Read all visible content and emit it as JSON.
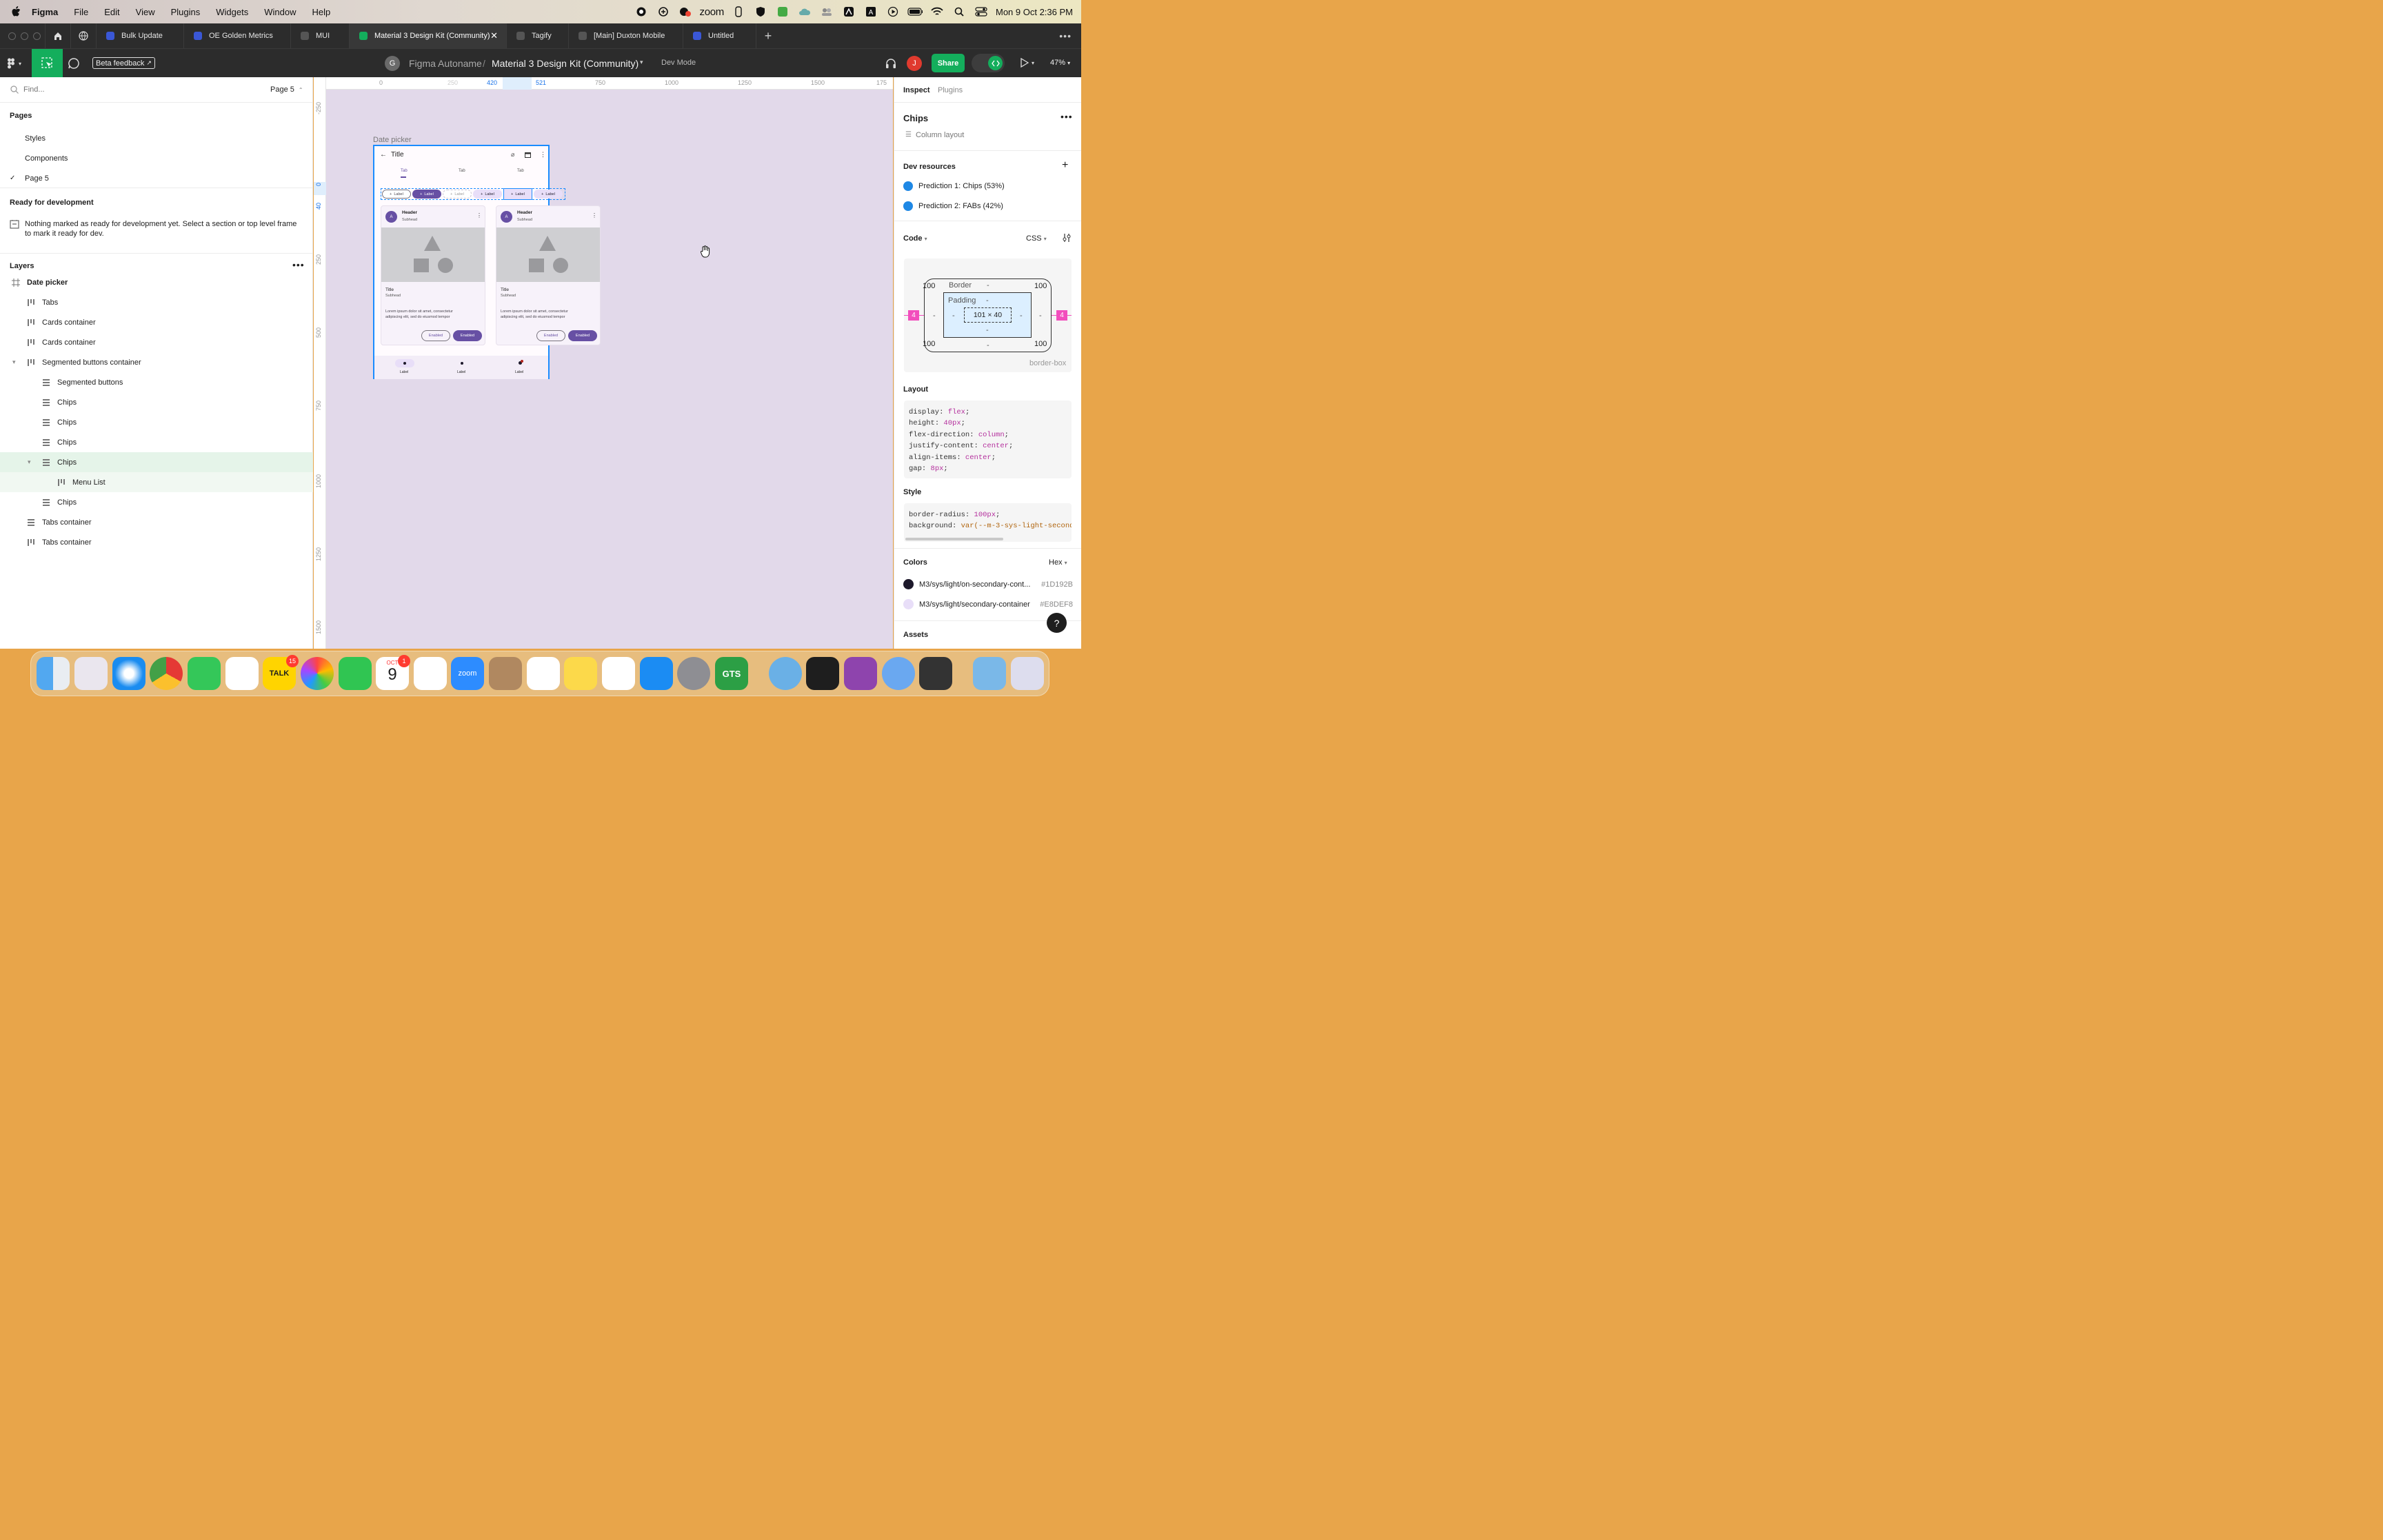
{
  "menubar": {
    "app": "Figma",
    "items": [
      "File",
      "Edit",
      "View",
      "Plugins",
      "Widgets",
      "Window",
      "Help"
    ],
    "status_zoom": "zoom",
    "clock": "Mon 9 Oct  2:36 PM"
  },
  "browser_tabs": [
    {
      "label": "Bulk Update",
      "color": "#3a57d6"
    },
    {
      "label": "OE Golden Metrics",
      "color": "#3a57d6"
    },
    {
      "label": "MUI",
      "color": "#555"
    },
    {
      "label": "Material 3 Design Kit (Community)",
      "color": "#14ae5c",
      "active": true
    },
    {
      "label": "Tagify",
      "color": "#555"
    },
    {
      "label": "[Main] Duxton Mobile",
      "color": "#555"
    },
    {
      "label": "Untitled",
      "color": "#3a57d6"
    }
  ],
  "toolbar": {
    "beta": "Beta feedback",
    "team_initial": "G",
    "team": "Figma Autoname",
    "sep": "/",
    "file": "Material 3 Design Kit (Community)",
    "devmode": "Dev Mode",
    "user_initial": "J",
    "share": "Share",
    "zoom": "47%"
  },
  "left": {
    "search_placeholder": "Find...",
    "page_select": "Page 5",
    "pages_title": "Pages",
    "pages": [
      "Styles",
      "Components",
      "Page 5"
    ],
    "ready_title": "Ready for development",
    "ready_text": "Nothing marked as ready for development yet. Select a section or top level frame to mark it ready for dev.",
    "layers_title": "Layers",
    "layers": [
      {
        "label": "Date picker",
        "icon": "frame-icon",
        "indent": 0,
        "bold": true
      },
      {
        "label": "Tabs",
        "icon": "autolayout-v-icon",
        "indent": 1
      },
      {
        "label": "Cards container",
        "icon": "autolayout-v-icon",
        "indent": 1
      },
      {
        "label": "Cards container",
        "icon": "autolayout-v-icon",
        "indent": 1
      },
      {
        "label": "Segmented buttons container",
        "icon": "autolayout-v-icon",
        "indent": 1,
        "caret": true
      },
      {
        "label": "Segmented buttons",
        "icon": "autolayout-h-icon",
        "indent": 2
      },
      {
        "label": "Chips",
        "icon": "autolayout-h-icon",
        "indent": 2
      },
      {
        "label": "Chips",
        "icon": "autolayout-h-icon",
        "indent": 2
      },
      {
        "label": "Chips",
        "icon": "autolayout-h-icon",
        "indent": 2
      },
      {
        "label": "Chips",
        "icon": "autolayout-h-icon",
        "indent": 2,
        "selected": true,
        "caret": true
      },
      {
        "label": "Menu List",
        "icon": "autolayout-v-icon",
        "indent": 3,
        "sub": true
      },
      {
        "label": "Chips",
        "icon": "autolayout-h-icon",
        "indent": 2
      },
      {
        "label": "Tabs container",
        "icon": "autolayout-h-icon",
        "indent": 1
      },
      {
        "label": "Tabs container",
        "icon": "autolayout-v-icon",
        "indent": 1
      }
    ]
  },
  "ruler": {
    "top": [
      "0",
      "250",
      "420",
      "521",
      "750",
      "1000",
      "1250",
      "1500",
      "175"
    ],
    "left": [
      "-250",
      "0",
      "40",
      "250",
      "500",
      "750",
      "1000",
      "1250",
      "1500"
    ]
  },
  "canvas": {
    "frame_label": "Date picker",
    "app_title": "Title",
    "tabs": [
      "Tab",
      "Tab",
      "Tab"
    ],
    "chip": "Label",
    "card_header": "Header",
    "card_sub": "Subhead",
    "card_avatar": "A",
    "card_title": "Title",
    "card_subhead": "Subhead",
    "card_body": "Lorem ipsum dolor sit amet, consectetur adipiscing elit, sed do eiusmod tempor",
    "btn": "Enabled",
    "nav_label": "Label"
  },
  "right": {
    "tabs": [
      "Inspect",
      "Plugins"
    ],
    "name": "Chips",
    "layout_type": "Column layout",
    "dev_title": "Dev resources",
    "predictions": [
      "Prediction 1: Chips (53%)",
      "Prediction 2: FABs (42%)"
    ],
    "code_title": "Code",
    "code_lang": "CSS",
    "box": {
      "radius": "100",
      "border": "Border",
      "padding": "Padding",
      "dash": "-",
      "size": "101 × 40",
      "margin": "4",
      "sizing": "border-box"
    },
    "layout_title": "Layout",
    "layout_code": [
      [
        "display",
        "flex"
      ],
      [
        "height",
        "40px"
      ],
      [
        "flex-direction",
        "column"
      ],
      [
        "justify-content",
        "center"
      ],
      [
        "align-items",
        "center"
      ],
      [
        "gap",
        "8px"
      ]
    ],
    "style_title": "Style",
    "style_code": [
      [
        "border-radius",
        "100px"
      ],
      [
        "background",
        "var(--m-3-sys-light-seconda"
      ]
    ],
    "colors_title": "Colors",
    "colors_fmt": "Hex",
    "colors": [
      {
        "name": "M3/sys/light/on-secondary-cont...",
        "hex": "#1D192B"
      },
      {
        "name": "M3/sys/light/secondary-container",
        "hex": "#E8DEF8"
      }
    ],
    "assets_title": "Assets"
  },
  "dock": {
    "talk_badge": "15",
    "cal_badge": "1",
    "cal_month": "OCT",
    "cal_day": "9",
    "talk": "TALK",
    "zoom": "zoom",
    "gts": "GTS"
  }
}
